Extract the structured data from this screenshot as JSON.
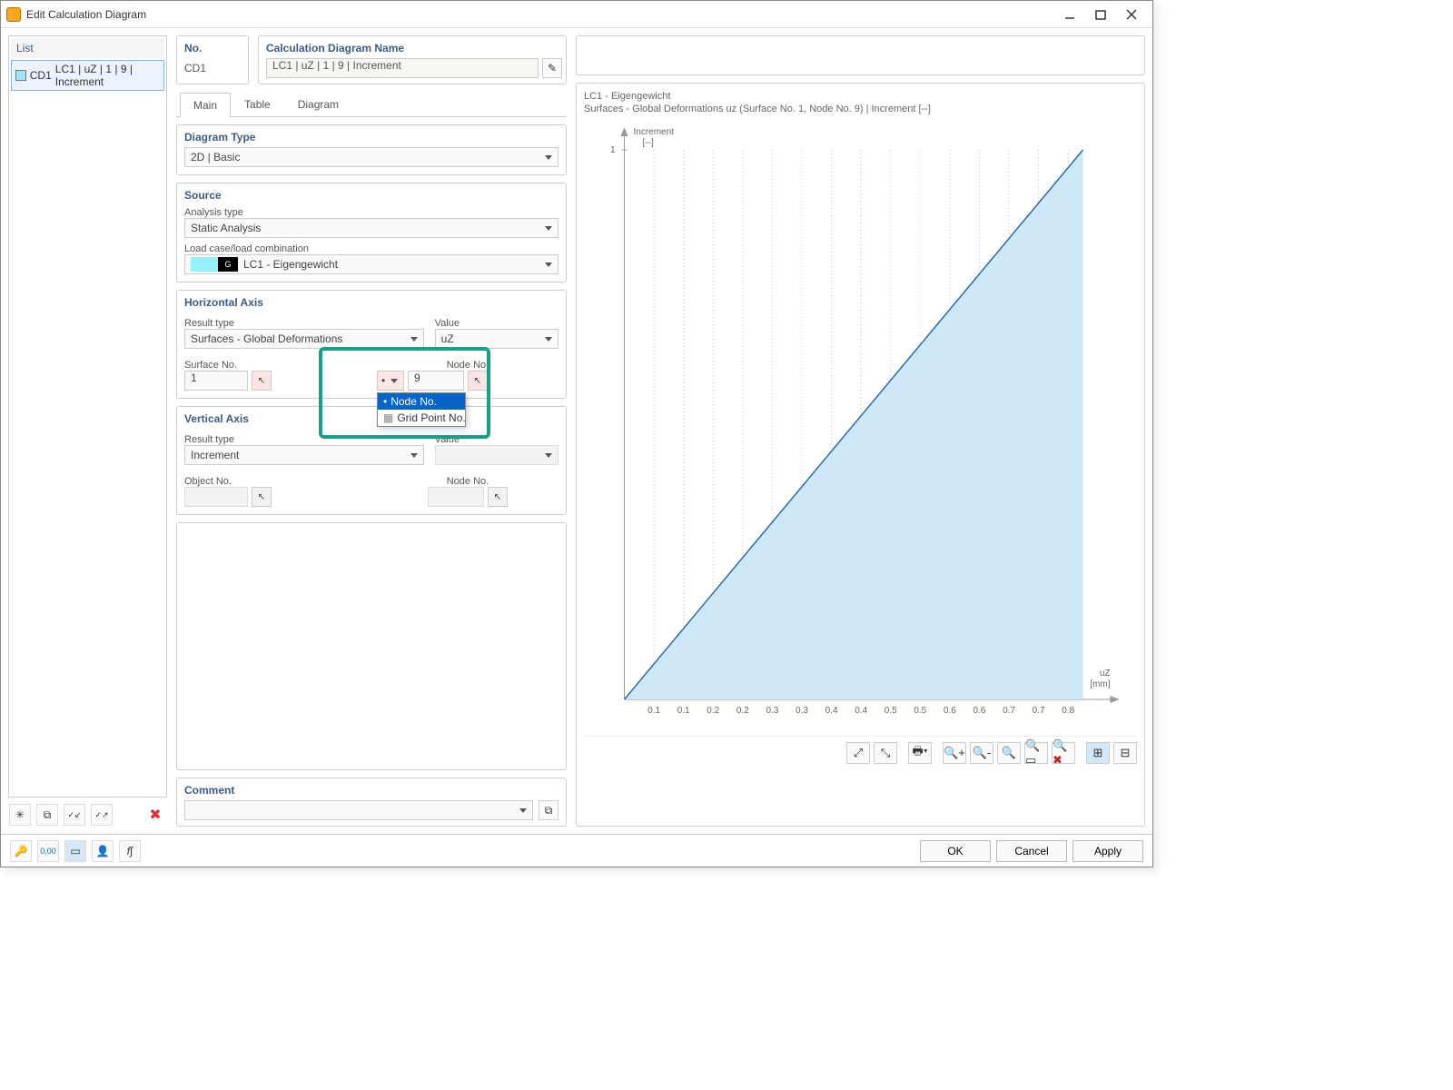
{
  "window": {
    "title": "Edit Calculation Diagram"
  },
  "list": {
    "header": "List",
    "items": [
      {
        "code": "CD1",
        "text": "LC1 | uZ | 1 | 9 | Increment"
      }
    ]
  },
  "no": {
    "header": "No.",
    "value": "CD1"
  },
  "name": {
    "header": "Calculation Diagram Name",
    "value": "LC1 | uZ | 1 | 9 | Increment"
  },
  "tabs": {
    "main": "Main",
    "table": "Table",
    "diagram": "Diagram"
  },
  "diagram_type": {
    "title": "Diagram Type",
    "value": "2D | Basic"
  },
  "source": {
    "title": "Source",
    "analysis_label": "Analysis type",
    "analysis_value": "Static Analysis",
    "lc_label": "Load case/load combination",
    "lc_tag": "G",
    "lc_value": "LC1 - Eigengewicht"
  },
  "haxis": {
    "title": "Horizontal Axis",
    "result_label": "Result type",
    "result_value": "Surfaces - Global Deformations",
    "value_label": "Value",
    "value_value": "uZ",
    "surface_label": "Surface No.",
    "surface_value": "1",
    "node_label": "Node No.",
    "node_value": "9",
    "dd_sel": "Node No.",
    "dd_opt2": "Grid Point No."
  },
  "vaxis": {
    "title": "Vertical Axis",
    "result_label": "Result type",
    "result_value": "Increment",
    "value_label": "Value",
    "obj_label": "Object No.",
    "node_label": "Node No."
  },
  "comment": {
    "title": "Comment"
  },
  "chart": {
    "title": "LC1 - Eigengewicht",
    "subtitle": "Surfaces - Global Deformations uz (Surface No. 1, Node No. 9) | Increment [--]",
    "y_label": "Increment",
    "y_unit": "[--]",
    "x_label": "uZ",
    "x_unit": "[mm]",
    "y_ticks": [
      "1"
    ],
    "x_ticks": [
      "0.1",
      "0.1",
      "0.2",
      "0.2",
      "0.3",
      "0.3",
      "0.4",
      "0.4",
      "0.5",
      "0.5",
      "0.6",
      "0.6",
      "0.7",
      "0.7",
      "0.8"
    ]
  },
  "footer": {
    "ok": "OK",
    "cancel": "Cancel",
    "apply": "Apply"
  },
  "status_icons": {
    "help": "❔",
    "num": "0,00"
  },
  "chart_data": {
    "type": "line",
    "x": [
      0,
      0.83
    ],
    "y": [
      0,
      1
    ],
    "title": "LC1 - Eigengewicht",
    "subtitle": "Surfaces - Global Deformations uz (Surface No. 1, Node No. 9) | Increment [--]",
    "xlabel": "uZ [mm]",
    "ylabel": "Increment [--]",
    "xlim": [
      0,
      0.9
    ],
    "ylim": [
      0,
      1.05
    ],
    "fill_under": true,
    "x_tick_values": [
      0.055,
      0.11,
      0.165,
      0.22,
      0.275,
      0.33,
      0.385,
      0.44,
      0.495,
      0.55,
      0.605,
      0.66,
      0.715,
      0.77,
      0.825
    ],
    "x_tick_labels": [
      "0.1",
      "0.1",
      "0.2",
      "0.2",
      "0.3",
      "0.3",
      "0.4",
      "0.4",
      "0.5",
      "0.5",
      "0.6",
      "0.6",
      "0.7",
      "0.7",
      "0.8"
    ],
    "y_tick_values": [
      1
    ],
    "y_tick_labels": [
      "1"
    ]
  }
}
